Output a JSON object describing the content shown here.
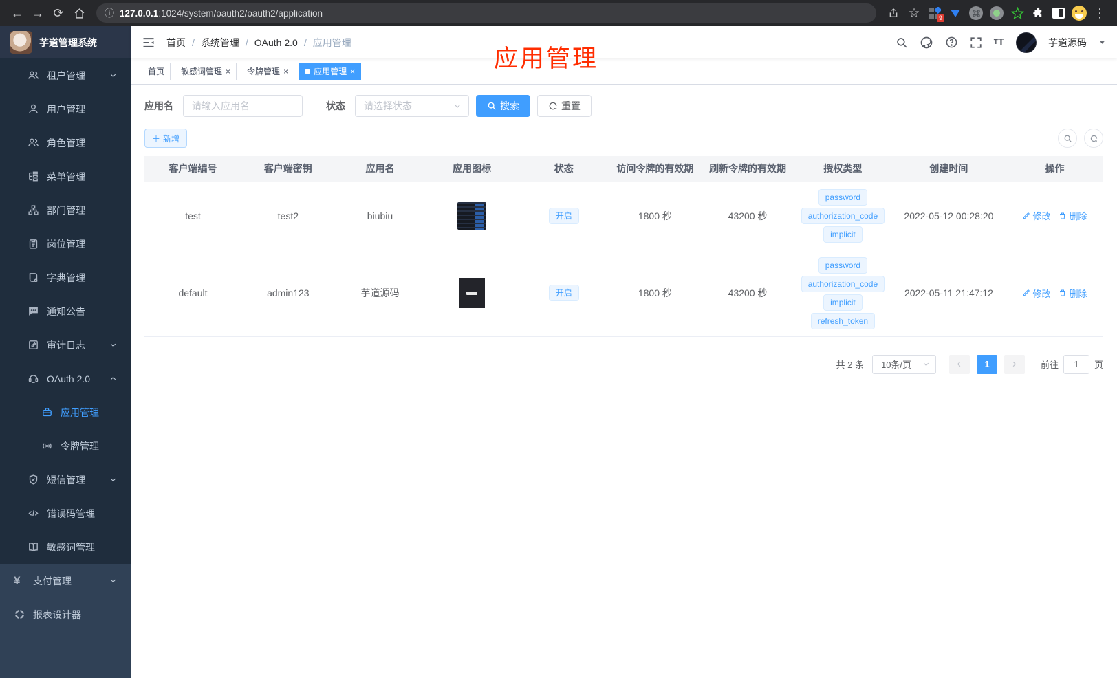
{
  "browser": {
    "url_host": "127.0.0.1",
    "url_rest": ":1024/system/oauth2/oauth2/application",
    "extension_badge": "9"
  },
  "icons": {
    "back": "←",
    "forward": "→",
    "reload": "⟳",
    "info": "ⓘ",
    "star": "☆",
    "dots": "⋮",
    "close": "×",
    "plus": "＋",
    "question": "?",
    "yen": "¥",
    "big_font": "T",
    "small_font": "T"
  },
  "annotation": {
    "text": "应用管理"
  },
  "sidebar": {
    "title": "芋道管理系统",
    "menu": [
      {
        "label": "租户管理"
      },
      {
        "label": "用户管理"
      },
      {
        "label": "角色管理"
      },
      {
        "label": "菜单管理"
      },
      {
        "label": "部门管理"
      },
      {
        "label": "岗位管理"
      },
      {
        "label": "字典管理"
      },
      {
        "label": "通知公告"
      },
      {
        "label": "审计日志"
      },
      {
        "label": "OAuth 2.0"
      },
      {
        "label": "应用管理"
      },
      {
        "label": "令牌管理"
      },
      {
        "label": "短信管理"
      },
      {
        "label": "错误码管理"
      },
      {
        "label": "敏感词管理"
      },
      {
        "label": "支付管理"
      },
      {
        "label": "报表设计器"
      }
    ]
  },
  "navbar": {
    "breadcrumb": [
      "首页",
      "系统管理",
      "OAuth 2.0",
      "应用管理"
    ],
    "username": "芋道源码"
  },
  "tabs": [
    {
      "label": "首页"
    },
    {
      "label": "敏感词管理"
    },
    {
      "label": "令牌管理"
    },
    {
      "label": "应用管理"
    }
  ],
  "filter": {
    "name_label": "应用名",
    "name_placeholder": "请输入应用名",
    "status_label": "状态",
    "status_placeholder": "请选择状态",
    "search_label": "搜索",
    "reset_label": "重置"
  },
  "toolbar": {
    "add_label": "新增"
  },
  "table": {
    "headers": [
      "客户端编号",
      "客户端密钥",
      "应用名",
      "应用图标",
      "状态",
      "访问令牌的有效期",
      "刷新令牌的有效期",
      "授权类型",
      "创建时间",
      "操作"
    ],
    "rows": [
      {
        "client_id": "test",
        "secret": "test2",
        "name": "biubiu",
        "status": "开启",
        "access_ttl": "1800 秒",
        "refresh_ttl": "43200 秒",
        "grants": [
          "password",
          "authorization_code",
          "implicit"
        ],
        "created": "2022-05-12 00:28:20",
        "edit": "修改",
        "delete": "删除"
      },
      {
        "client_id": "default",
        "secret": "admin123",
        "name": "芋道源码",
        "status": "开启",
        "access_ttl": "1800 秒",
        "refresh_ttl": "43200 秒",
        "grants": [
          "password",
          "authorization_code",
          "implicit",
          "refresh_token"
        ],
        "created": "2022-05-11 21:47:12",
        "edit": "修改",
        "delete": "删除"
      }
    ]
  },
  "pagination": {
    "total": "共 2 条",
    "page_size": "10条/页",
    "current": "1",
    "goto_prefix": "前往",
    "goto_value": "1",
    "goto_suffix": "页"
  },
  "colors": {
    "accent": "#409eff",
    "tag_bg": "#ecf5ff",
    "sidebar_bg": "#304156",
    "submenu_bg": "#1f2d3d",
    "annotation_red": "#ff2d00"
  }
}
